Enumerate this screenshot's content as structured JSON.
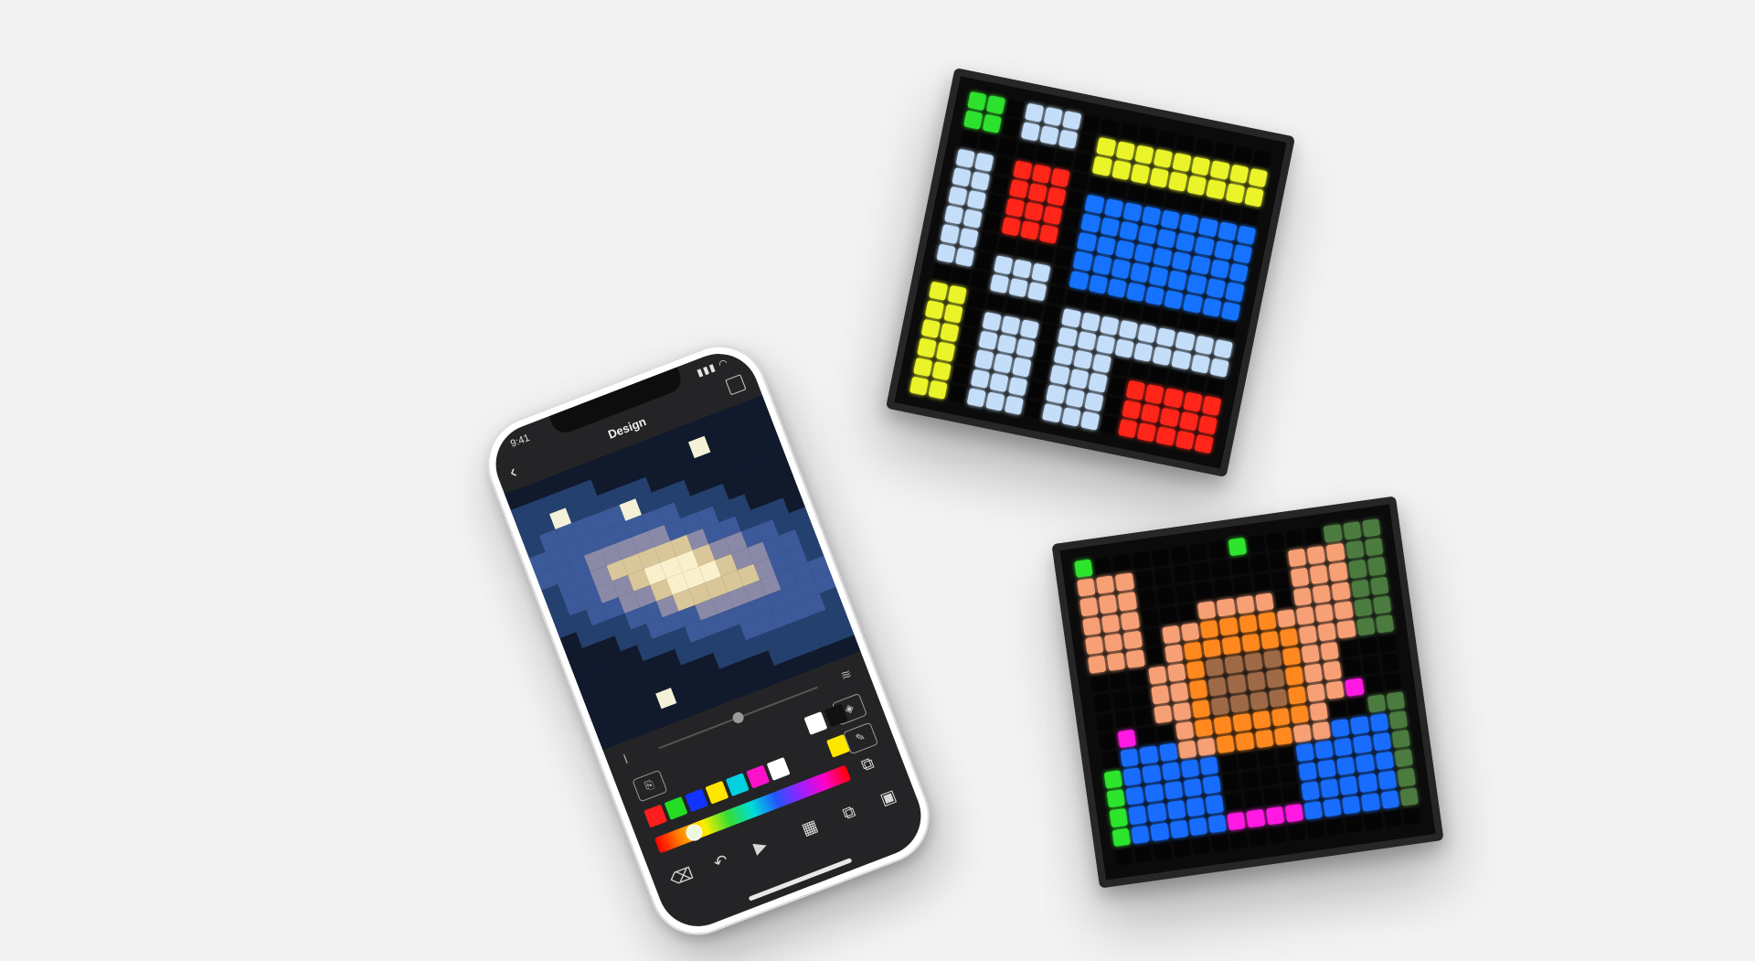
{
  "phone": {
    "status_time": "9:41",
    "status_icons": "▮▮▮ ◠",
    "nav_title": "Design",
    "back_glyph": "‹",
    "tools": {
      "camera_glyph": "⎘",
      "fill_glyph": "◈",
      "picker_glyph": "✎",
      "eraser_glyph": "⌫",
      "undo_glyph": "↶",
      "play_glyph": "▶",
      "gallery_glyph": "▦",
      "save_glyph": "▣",
      "import_glyph": "⧉"
    },
    "palette_row1": [
      "#ffffff",
      "#111111"
    ],
    "palette_row2": [
      "#ff1d1d",
      "#22dd22",
      "#1133ff",
      "#ffe600",
      "#00d0e0",
      "#ff11cc",
      "#ffffff"
    ],
    "accent_yellow": "#ffe600"
  },
  "colors": {
    "background": "#f3f3f3",
    "panel_bezel": "#262626",
    "phone_screen": "#242426"
  }
}
